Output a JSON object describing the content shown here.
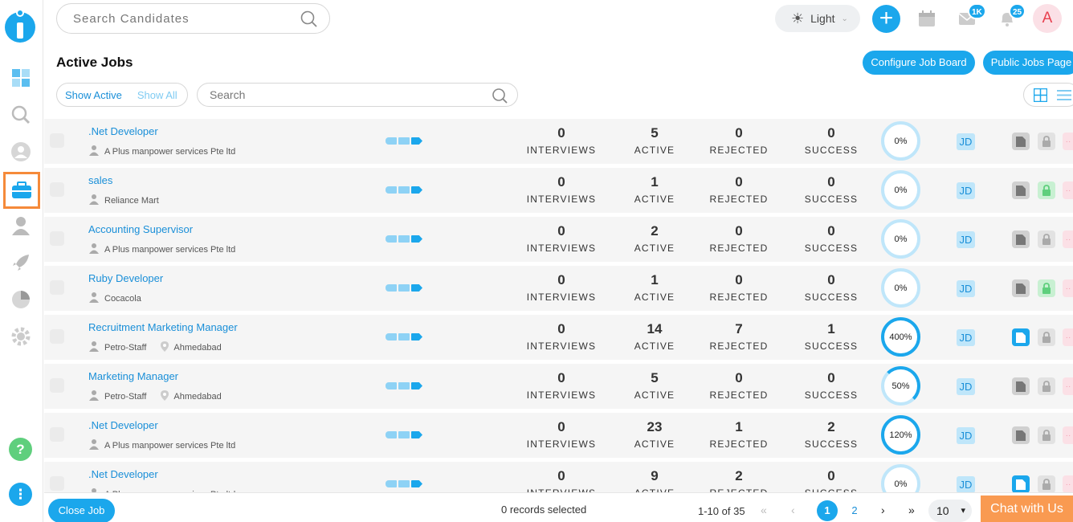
{
  "header": {
    "search_placeholder": "Search Candidates",
    "theme_label": "Light",
    "mail_badge": "1K",
    "notif_badge": "25",
    "avatar_letter": "A"
  },
  "page": {
    "title": "Active Jobs",
    "configure_label": "Configure Job Board",
    "public_label": "Public Jobs Page",
    "show_active": "Show Active",
    "show_all": "Show All",
    "search_placeholder": "Search"
  },
  "stat_labels": {
    "interviews": "INTERVIEWS",
    "active": "ACTIVE",
    "rejected": "REJECTED",
    "success": "SUCCESS"
  },
  "jd_label": "JD",
  "jobs": [
    {
      "title": ".Net Developer",
      "company": "A Plus manpower services Pte ltd",
      "location": "",
      "interviews": "0",
      "active": "5",
      "rejected": "0",
      "success": "0",
      "percent": "0%",
      "pct_value": 0,
      "file_active": false,
      "lock_open": false
    },
    {
      "title": "sales",
      "company": "Reliance Mart",
      "location": "",
      "interviews": "0",
      "active": "1",
      "rejected": "0",
      "success": "0",
      "percent": "0%",
      "pct_value": 0,
      "file_active": false,
      "lock_open": true
    },
    {
      "title": "Accounting Supervisor",
      "company": "A Plus manpower services Pte ltd",
      "location": "",
      "interviews": "0",
      "active": "2",
      "rejected": "0",
      "success": "0",
      "percent": "0%",
      "pct_value": 0,
      "file_active": false,
      "lock_open": false
    },
    {
      "title": "Ruby Developer",
      "company": "Cocacola",
      "location": "",
      "interviews": "0",
      "active": "1",
      "rejected": "0",
      "success": "0",
      "percent": "0%",
      "pct_value": 0,
      "file_active": false,
      "lock_open": true
    },
    {
      "title": "Recruitment Marketing Manager",
      "company": "Petro-Staff",
      "location": "Ahmedabad",
      "interviews": "0",
      "active": "14",
      "rejected": "7",
      "success": "1",
      "percent": "400%",
      "pct_value": 400,
      "file_active": true,
      "lock_open": false
    },
    {
      "title": "Marketing Manager",
      "company": "Petro-Staff",
      "location": "Ahmedabad",
      "interviews": "0",
      "active": "5",
      "rejected": "0",
      "success": "0",
      "percent": "50%",
      "pct_value": 50,
      "file_active": false,
      "lock_open": false
    },
    {
      "title": ".Net Developer",
      "company": "A Plus manpower services Pte ltd",
      "location": "",
      "interviews": "0",
      "active": "23",
      "rejected": "1",
      "success": "2",
      "percent": "120%",
      "pct_value": 120,
      "file_active": false,
      "lock_open": false
    },
    {
      "title": ".Net Developer",
      "company": "A Plus manpower services Pte ltd",
      "location": "",
      "interviews": "0",
      "active": "9",
      "rejected": "2",
      "success": "0",
      "percent": "0%",
      "pct_value": 0,
      "file_active": true,
      "lock_open": false
    }
  ],
  "footer": {
    "close_label": "Close Job",
    "selected": "0 records selected",
    "range": "1-10 of 35",
    "page1": "1",
    "page2": "2",
    "page_size": "10",
    "chat_label": "Chat with Us"
  },
  "colors": {
    "accent": "#1ba7ec",
    "accent_light": "#bfe6fa",
    "highlight": "#f58a3a",
    "chat": "#f99a51",
    "green": "#5fcf7d"
  }
}
